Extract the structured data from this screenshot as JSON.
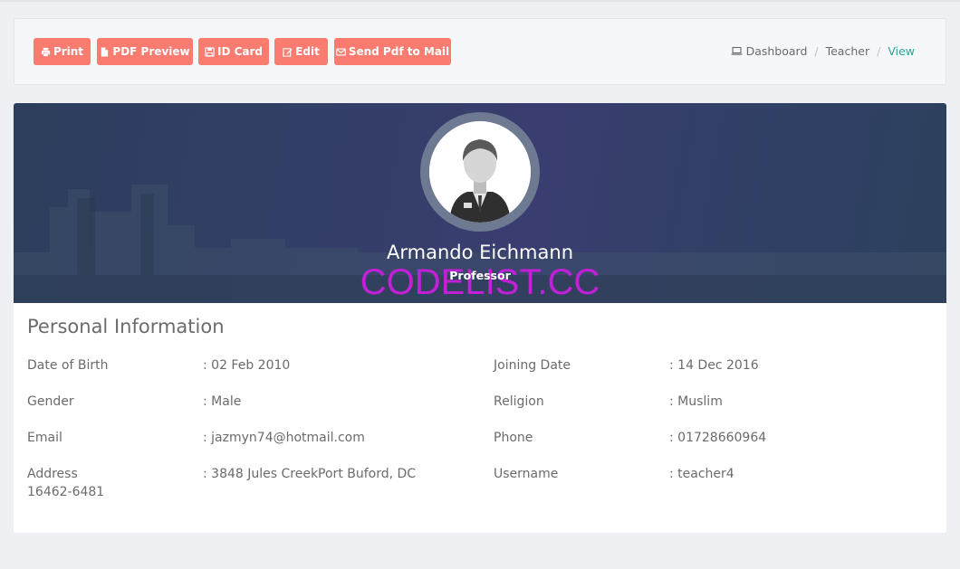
{
  "toolbar": {
    "buttons": [
      {
        "label": "Print",
        "icon": "print-icon"
      },
      {
        "label": "PDF Preview",
        "icon": "file-icon"
      },
      {
        "label": "ID Card",
        "icon": "save-icon"
      },
      {
        "label": "Edit",
        "icon": "edit-icon"
      },
      {
        "label": "Send Pdf to Mail",
        "icon": "envelope-icon"
      }
    ],
    "button_color": "#fa7b6f"
  },
  "breadcrumb": {
    "items": [
      {
        "label": "Dashboard",
        "icon": "laptop-icon"
      },
      {
        "label": "Teacher"
      },
      {
        "label": "View"
      }
    ],
    "active_color": "#27a79a"
  },
  "profile": {
    "name": "Armando Eichmann",
    "role": "Professor",
    "watermark": "CODELIST.CC"
  },
  "personal_info": {
    "title": "Personal Information",
    "left": [
      {
        "label": "Date of Birth",
        "value": ": 02 Feb 2010"
      },
      {
        "label": "Gender",
        "value": ": Male"
      },
      {
        "label": "Email",
        "value": ": jazmyn74@hotmail.com"
      },
      {
        "label": "Address",
        "value": ": 3848 Jules CreekPort Buford, DC",
        "value_cont": "16462-6481"
      }
    ],
    "right": [
      {
        "label": "Joining Date",
        "value": ": 14 Dec 2016"
      },
      {
        "label": "Religion",
        "value": ": Muslim"
      },
      {
        "label": "Phone",
        "value": ": 01728660964"
      },
      {
        "label": "Username",
        "value": ": teacher4"
      }
    ]
  }
}
